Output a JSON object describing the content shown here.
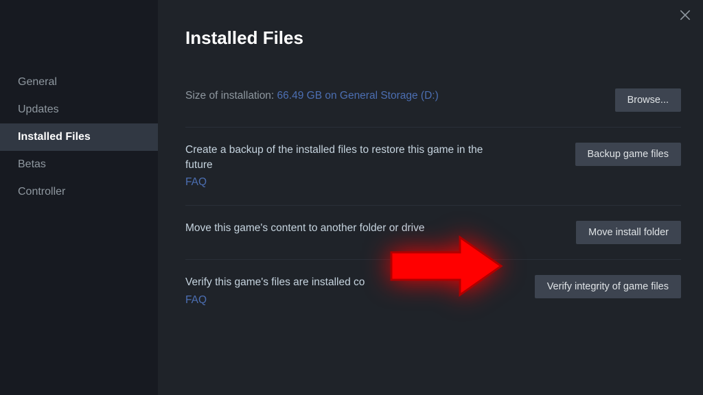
{
  "sidebar": {
    "items": [
      {
        "label": "General"
      },
      {
        "label": "Updates"
      },
      {
        "label": "Installed Files"
      },
      {
        "label": "Betas"
      },
      {
        "label": "Controller"
      }
    ]
  },
  "header": {
    "title": "Installed Files"
  },
  "sections": {
    "size": {
      "label": "Size of installation: ",
      "value": "66.49 GB on General Storage (D:)",
      "button": "Browse..."
    },
    "backup": {
      "description": "Create a backup of the installed files to restore this game in the future",
      "faq": "FAQ",
      "button": "Backup game files"
    },
    "move": {
      "description": "Move this game's content to another folder or drive",
      "button": "Move install folder"
    },
    "verify": {
      "description": "Verify this game's files are installed co",
      "faq": "FAQ",
      "button": "Verify integrity of game files"
    }
  }
}
